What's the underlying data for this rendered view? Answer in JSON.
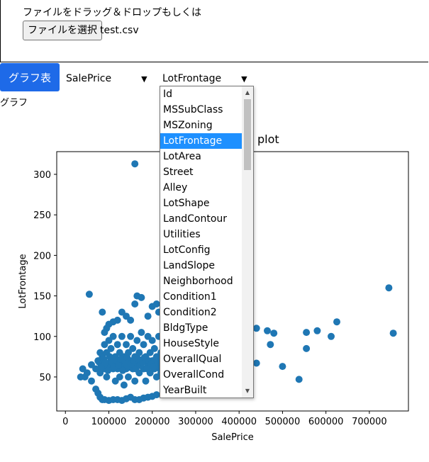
{
  "upload": {
    "drop_label": "ファイルをドラッグ＆ドロップもしくは",
    "file_button": "ファイルを選択",
    "file_name": "test.csv"
  },
  "controls": {
    "graph_button": "グラフ表示",
    "x_select": "SalePrice",
    "y_select": "LotFrontage",
    "graph_label": "グラフ"
  },
  "dropdown": {
    "items": [
      "Id",
      "MSSubClass",
      "MSZoning",
      "LotFrontage",
      "LotArea",
      "Street",
      "Alley",
      "LotShape",
      "LandContour",
      "Utilities",
      "LotConfig",
      "LandSlope",
      "Neighborhood",
      "Condition1",
      "Condition2",
      "BldgType",
      "HouseStyle",
      "OverallQual",
      "OverallCond",
      "YearBuilt"
    ],
    "selected_index": 3
  },
  "chart_data": {
    "type": "scatter",
    "title": "plot",
    "xlabel": "SalePrice",
    "ylabel": "LotFrontage",
    "xlim": [
      -20000,
      790000
    ],
    "ylim": [
      8,
      328
    ],
    "xticks": [
      0,
      100000,
      200000,
      300000,
      400000,
      500000,
      600000,
      700000
    ],
    "yticks": [
      50,
      100,
      150,
      200,
      250,
      300
    ],
    "color": "#1f77b4",
    "points": [
      [
        160000,
        313
      ],
      [
        55000,
        152
      ],
      [
        745000,
        160
      ],
      [
        755000,
        104
      ],
      [
        625000,
        118
      ],
      [
        612000,
        100
      ],
      [
        580000,
        107
      ],
      [
        555000,
        105
      ],
      [
        555000,
        85
      ],
      [
        538000,
        47
      ],
      [
        500000,
        63
      ],
      [
        480000,
        104
      ],
      [
        472000,
        90
      ],
      [
        465000,
        107
      ],
      [
        440000,
        67
      ],
      [
        440000,
        110
      ],
      [
        165000,
        150
      ],
      [
        175000,
        148
      ],
      [
        190000,
        125
      ],
      [
        200000,
        137
      ],
      [
        210000,
        140
      ],
      [
        215000,
        130
      ],
      [
        225000,
        122
      ],
      [
        160000,
        140
      ],
      [
        140000,
        125
      ],
      [
        150000,
        120
      ],
      [
        130000,
        130
      ],
      [
        85000,
        130
      ],
      [
        120000,
        120
      ],
      [
        110000,
        118
      ],
      [
        100000,
        115
      ],
      [
        95000,
        110
      ],
      [
        90000,
        105
      ],
      [
        40000,
        60
      ],
      [
        45000,
        50
      ],
      [
        50000,
        55
      ],
      [
        35000,
        50
      ],
      [
        60000,
        65
      ],
      [
        60000,
        45
      ],
      [
        70000,
        35
      ],
      [
        75000,
        30
      ],
      [
        80000,
        25
      ],
      [
        85000,
        22
      ],
      [
        90000,
        22
      ],
      [
        100000,
        21
      ],
      [
        110000,
        22
      ],
      [
        120000,
        22
      ],
      [
        130000,
        21
      ],
      [
        140000,
        23
      ],
      [
        150000,
        25
      ],
      [
        160000,
        22
      ],
      [
        170000,
        22
      ],
      [
        180000,
        24
      ],
      [
        190000,
        25
      ],
      [
        200000,
        26
      ],
      [
        210000,
        28
      ],
      [
        70000,
        60
      ],
      [
        75000,
        70
      ],
      [
        80000,
        55
      ],
      [
        80000,
        80
      ],
      [
        85000,
        75
      ],
      [
        90000,
        60
      ],
      [
        90000,
        90
      ],
      [
        95000,
        50
      ],
      [
        95000,
        80
      ],
      [
        100000,
        65
      ],
      [
        100000,
        95
      ],
      [
        105000,
        70
      ],
      [
        105000,
        85
      ],
      [
        110000,
        60
      ],
      [
        110000,
        100
      ],
      [
        115000,
        75
      ],
      [
        115000,
        45
      ],
      [
        120000,
        60
      ],
      [
        120000,
        90
      ],
      [
        125000,
        80
      ],
      [
        125000,
        50
      ],
      [
        130000,
        65
      ],
      [
        130000,
        100
      ],
      [
        135000,
        75
      ],
      [
        135000,
        40
      ],
      [
        140000,
        60
      ],
      [
        140000,
        90
      ],
      [
        145000,
        80
      ],
      [
        145000,
        50
      ],
      [
        150000,
        70
      ],
      [
        150000,
        100
      ],
      [
        155000,
        60
      ],
      [
        155000,
        85
      ],
      [
        160000,
        75
      ],
      [
        160000,
        45
      ],
      [
        165000,
        65
      ],
      [
        165000,
        95
      ],
      [
        170000,
        80
      ],
      [
        170000,
        55
      ],
      [
        175000,
        70
      ],
      [
        175000,
        105
      ],
      [
        180000,
        60
      ],
      [
        180000,
        90
      ],
      [
        185000,
        75
      ],
      [
        185000,
        45
      ],
      [
        190000,
        65
      ],
      [
        190000,
        100
      ],
      [
        195000,
        80
      ],
      [
        195000,
        55
      ],
      [
        200000,
        70
      ],
      [
        200000,
        95
      ],
      [
        205000,
        60
      ],
      [
        205000,
        85
      ],
      [
        210000,
        75
      ],
      [
        210000,
        50
      ],
      [
        215000,
        65
      ],
      [
        215000,
        100
      ],
      [
        220000,
        80
      ],
      [
        220000,
        55
      ],
      [
        225000,
        70
      ],
      [
        225000,
        105
      ],
      [
        78000,
        68
      ],
      [
        82000,
        62
      ],
      [
        88000,
        72
      ],
      [
        92000,
        68
      ],
      [
        98000,
        58
      ],
      [
        102000,
        75
      ],
      [
        108000,
        68
      ],
      [
        112000,
        62
      ],
      [
        118000,
        70
      ],
      [
        122000,
        65
      ],
      [
        128000,
        72
      ],
      [
        132000,
        58
      ],
      [
        138000,
        68
      ],
      [
        142000,
        74
      ],
      [
        148000,
        62
      ],
      [
        152000,
        66
      ],
      [
        158000,
        70
      ],
      [
        162000,
        60
      ],
      [
        168000,
        72
      ],
      [
        172000,
        64
      ],
      [
        178000,
        68
      ],
      [
        182000,
        74
      ],
      [
        188000,
        60
      ],
      [
        192000,
        70
      ],
      [
        198000,
        66
      ],
      [
        202000,
        62
      ],
      [
        208000,
        72
      ],
      [
        212000,
        68
      ],
      [
        218000,
        60
      ],
      [
        222000,
        74
      ]
    ]
  }
}
